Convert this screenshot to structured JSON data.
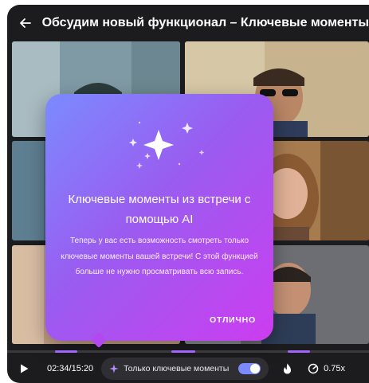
{
  "header": {
    "title": "Обсудим новый функционал – Ключевые моменты",
    "back_icon": "arrow-left-icon"
  },
  "popup": {
    "title": "Ключевые моменты из встречи с помощью AI",
    "body": "Теперь у вас есть возможность смотреть только ключевые моменты вашей встречи! С этой функцией больше не нужно просматривать всю запись.",
    "ok_label": "ОТЛИЧНО",
    "icon": "sparkles-icon"
  },
  "controls": {
    "play_icon": "play-icon",
    "time": "02:34/15:20",
    "key_moments_label": "Только ключевые моменты",
    "key_moments_enabled": true,
    "flame_icon": "flame-icon",
    "speed_icon": "speedometer-icon",
    "speed_label": "0.75x"
  },
  "colors": {
    "accent": "#7b8bff",
    "popup_gradient_start": "#7b8bff",
    "popup_gradient_end": "#cc3df0",
    "background": "#1c1c1e"
  }
}
